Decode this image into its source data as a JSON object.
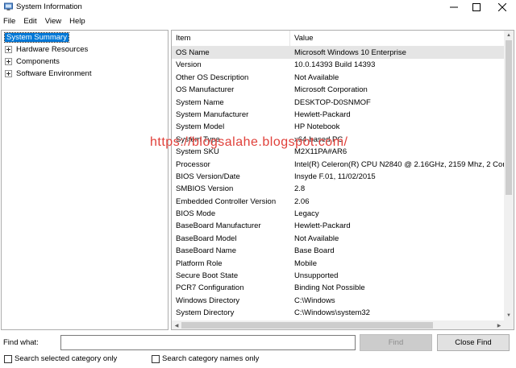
{
  "window": {
    "title": "System Information",
    "icon": "system-information-icon"
  },
  "menu": [
    "File",
    "Edit",
    "View",
    "Help"
  ],
  "tree": [
    {
      "label": "System Summary",
      "selected": true,
      "expandable": false
    },
    {
      "label": "Hardware Resources",
      "selected": false,
      "expandable": true
    },
    {
      "label": "Components",
      "selected": false,
      "expandable": true
    },
    {
      "label": "Software Environment",
      "selected": false,
      "expandable": true
    }
  ],
  "list": {
    "columns": [
      "Item",
      "Value"
    ],
    "rows": [
      {
        "item": "OS Name",
        "value": "Microsoft Windows 10 Enterprise",
        "selected": true
      },
      {
        "item": "Version",
        "value": "10.0.14393 Build 14393"
      },
      {
        "item": "Other OS Description",
        "value": "Not Available"
      },
      {
        "item": "OS Manufacturer",
        "value": "Microsoft Corporation"
      },
      {
        "item": "System Name",
        "value": "DESKTOP-D0SNMOF"
      },
      {
        "item": "System Manufacturer",
        "value": "Hewlett-Packard"
      },
      {
        "item": "System Model",
        "value": "HP Notebook"
      },
      {
        "item": "System Type",
        "value": "x64-based PC"
      },
      {
        "item": "System SKU",
        "value": "M2X11PA#AR6"
      },
      {
        "item": "Processor",
        "value": "Intel(R) Celeron(R) CPU  N2840  @ 2.16GHz, 2159 Mhz, 2 Cor"
      },
      {
        "item": "BIOS Version/Date",
        "value": "Insyde F.01, 11/02/2015"
      },
      {
        "item": "SMBIOS Version",
        "value": "2.8"
      },
      {
        "item": "Embedded Controller Version",
        "value": "2.06"
      },
      {
        "item": "BIOS Mode",
        "value": "Legacy"
      },
      {
        "item": "BaseBoard Manufacturer",
        "value": "Hewlett-Packard"
      },
      {
        "item": "BaseBoard Model",
        "value": "Not Available"
      },
      {
        "item": "BaseBoard Name",
        "value": "Base Board"
      },
      {
        "item": "Platform Role",
        "value": "Mobile"
      },
      {
        "item": "Secure Boot State",
        "value": "Unsupported"
      },
      {
        "item": "PCR7 Configuration",
        "value": "Binding Not Possible"
      },
      {
        "item": "Windows Directory",
        "value": "C:\\Windows"
      },
      {
        "item": "System Directory",
        "value": "C:\\Windows\\system32"
      }
    ]
  },
  "watermark": "https://blogsalahe.blogspot.com/",
  "find": {
    "label": "Find what:",
    "value": "",
    "find_button": "Find",
    "close_find_button": "Close Find",
    "search_selected_label": "Search selected category only",
    "search_names_label": "Search category names only"
  }
}
